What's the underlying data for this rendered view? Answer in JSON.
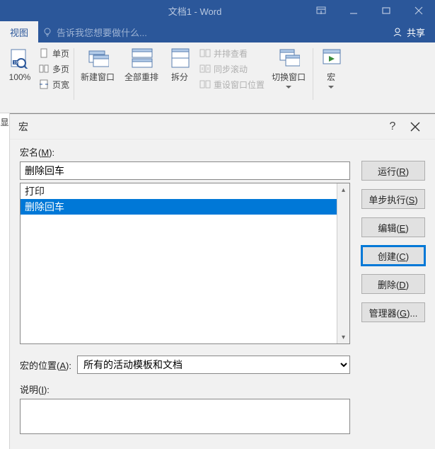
{
  "titlebar": {
    "title": "文档1 - Word"
  },
  "tabs": {
    "view": "视图",
    "tellme": "告诉我您想要做什么...",
    "share": "共享"
  },
  "ribbon": {
    "zoom_pct": "100%",
    "single_page": "单页",
    "multi_page": "多页",
    "page_width": "页宽",
    "new_window": "新建窗口",
    "arrange_all": "全部重排",
    "split": "拆分",
    "side_by_side": "并排查看",
    "sync_scroll": "同步滚动",
    "reset_pos": "重设窗口位置",
    "switch_win": "切换窗口",
    "macros": "宏"
  },
  "left_sliver": "显",
  "dialog": {
    "title": "宏",
    "macro_name_label": "宏名(M):",
    "macro_name_value": "删除回车",
    "list": [
      "打印",
      "删除回车"
    ],
    "selected_index": 1,
    "location_label": "宏的位置(A):",
    "location_value": "所有的活动模板和文档",
    "desc_label": "说明(I):",
    "buttons": {
      "run": "运行(R)",
      "step": "单步执行(S)",
      "edit": "编辑(E)",
      "create": "创建(C)",
      "delete": "删除(D)",
      "organizer": "管理器(G)..."
    }
  }
}
